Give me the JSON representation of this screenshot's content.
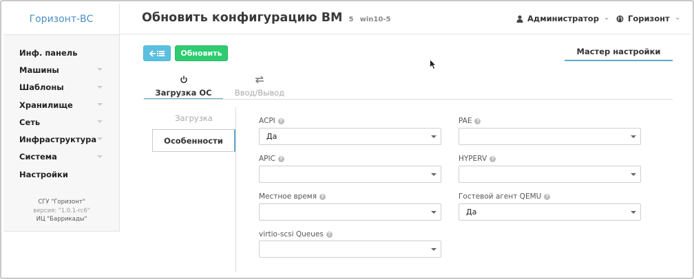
{
  "sidebar": {
    "brand": "Горизонт-ВС",
    "items": [
      {
        "label": "Инф. панель",
        "has_caret": false
      },
      {
        "label": "Машины",
        "has_caret": true
      },
      {
        "label": "Шаблоны",
        "has_caret": true
      },
      {
        "label": "Хранилище",
        "has_caret": true
      },
      {
        "label": "Сеть",
        "has_caret": true
      },
      {
        "label": "Инфраструктура",
        "has_caret": true
      },
      {
        "label": "Система",
        "has_caret": true
      },
      {
        "label": "Настройки",
        "has_caret": false
      }
    ],
    "footer": {
      "line1": "СГУ \"Горизонт\"",
      "line2": "версия: \"1.0.1-rc6\"",
      "line3": "ИЦ \"Баррикады\""
    }
  },
  "header": {
    "title": "Обновить конфигурацию ВМ",
    "vm_id": "5",
    "vm_name": "win10-5",
    "user": "Администратор",
    "org": "Горизонт"
  },
  "toolbar": {
    "back_icon": "back-to-list-icon",
    "update_label": "Обновить",
    "wizard_label": "Мастер настройки"
  },
  "tabs": {
    "os_label": "Загрузка ОС",
    "os_icon": "power-icon",
    "io_label": "Ввод/Вывод",
    "io_icon": "exchange-icon"
  },
  "subtabs": {
    "boot_label": "Загрузка",
    "features_label": "Особенности"
  },
  "fields": {
    "acpi": {
      "label": "ACPI",
      "value": "Да"
    },
    "pae": {
      "label": "PAE",
      "value": ""
    },
    "apic": {
      "label": "APIC",
      "value": ""
    },
    "hyperv": {
      "label": "HYPERV",
      "value": ""
    },
    "localtime": {
      "label": "Местное время",
      "value": ""
    },
    "qemu_agent": {
      "label": "Гостевой агент QEMU",
      "value": "Да"
    },
    "virtio_scsi": {
      "label": "virtio-scsi Queues",
      "value": ""
    }
  },
  "colors": {
    "brand": "#4a8fc4",
    "info_button": "#5bc0de",
    "success_button": "#2ecc71",
    "active_tab_border": "#5aa9c8"
  }
}
